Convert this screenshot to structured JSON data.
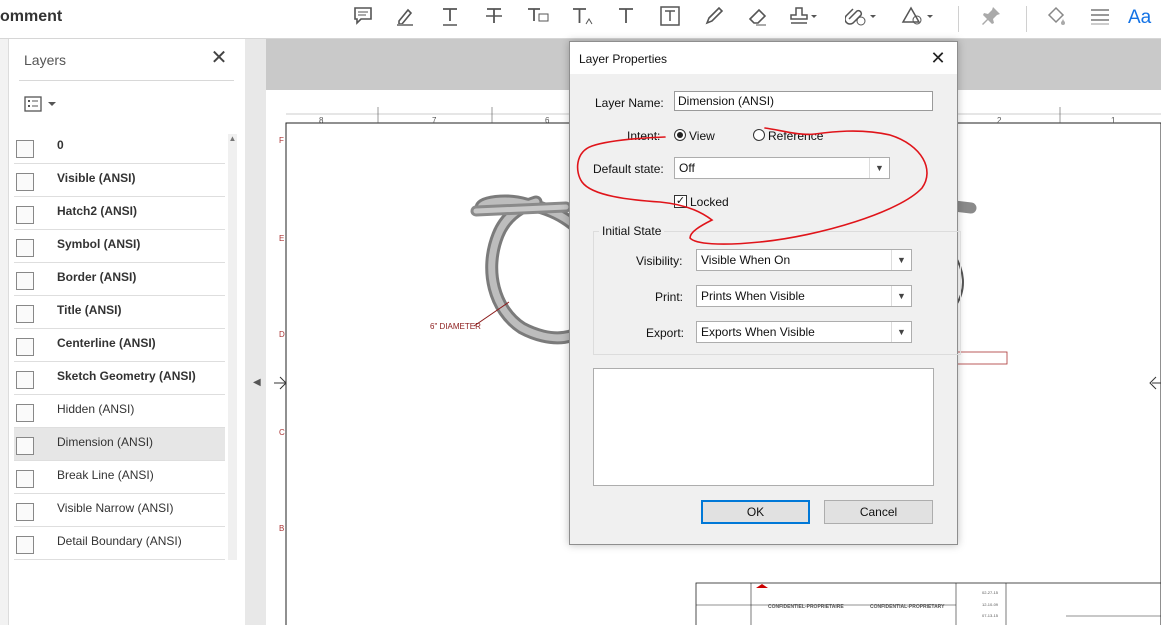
{
  "toolbar": {
    "title": "omment",
    "aa_label": "Aa",
    "icons": [
      "comment-icon",
      "highlight-icon",
      "underline-text-icon",
      "strikethrough-text-icon",
      "replace-text-icon",
      "insert-text-icon",
      "add-text-icon",
      "text-box-icon",
      "pencil-icon",
      "eraser-icon",
      "stamp-icon",
      "attach-icon",
      "shapes-icon",
      "pin-icon",
      "fill-icon",
      "lines-icon"
    ]
  },
  "layers_panel": {
    "title": "Layers",
    "close_glyph": "✕",
    "items": [
      {
        "label": "0",
        "bold": true
      },
      {
        "label": "Visible (ANSI)",
        "bold": true
      },
      {
        "label": "Hatch2 (ANSI)",
        "bold": true
      },
      {
        "label": "Symbol (ANSI)",
        "bold": true
      },
      {
        "label": "Border (ANSI)",
        "bold": true
      },
      {
        "label": "Title (ANSI)",
        "bold": true
      },
      {
        "label": "Centerline (ANSI)",
        "bold": true
      },
      {
        "label": "Sketch Geometry (ANSI)",
        "bold": true
      },
      {
        "label": "Hidden (ANSI)",
        "bold": false
      },
      {
        "label": "Dimension (ANSI)",
        "bold": false,
        "selected": true
      },
      {
        "label": "Break Line (ANSI)",
        "bold": false
      },
      {
        "label": "Visible Narrow (ANSI)",
        "bold": false
      },
      {
        "label": "Detail Boundary (ANSI)",
        "bold": false
      }
    ]
  },
  "document": {
    "column_numbers": [
      "8",
      "7",
      "6",
      "2",
      "1"
    ],
    "row_letters": [
      "F",
      "E",
      "D",
      "C",
      "B"
    ],
    "diameter_label": "6\" DIAMETER",
    "title_block": {
      "confidential_left": "CONFIDENTIEL-PROPRIETAIRE",
      "confidential_right": "CONFIDENTIAL-PROPRIETARY",
      "dates": [
        "02-27-15",
        "12-10-09",
        "07-13-15"
      ]
    }
  },
  "dialog": {
    "title": "Layer Properties",
    "close_glyph": "✕",
    "layer_name_label": "Layer Name:",
    "layer_name_value": "Dimension (ANSI)",
    "intent_label": "Intent:",
    "intent_options": [
      "View",
      "Reference"
    ],
    "intent_selected": "View",
    "default_state_label": "Default state:",
    "default_state_value": "Off",
    "locked_label": "Locked",
    "locked_checked": true,
    "initial_state_title": "Initial State",
    "visibility_label": "Visibility:",
    "visibility_value": "Visible When On",
    "print_label": "Print:",
    "print_value": "Prints When Visible",
    "export_label": "Export:",
    "export_value": "Exports When Visible",
    "ok_label": "OK",
    "cancel_label": "Cancel"
  },
  "colors": {
    "annotation": "#e0141a",
    "accent": "#0078d7",
    "brand_aa": "#1473e6"
  }
}
